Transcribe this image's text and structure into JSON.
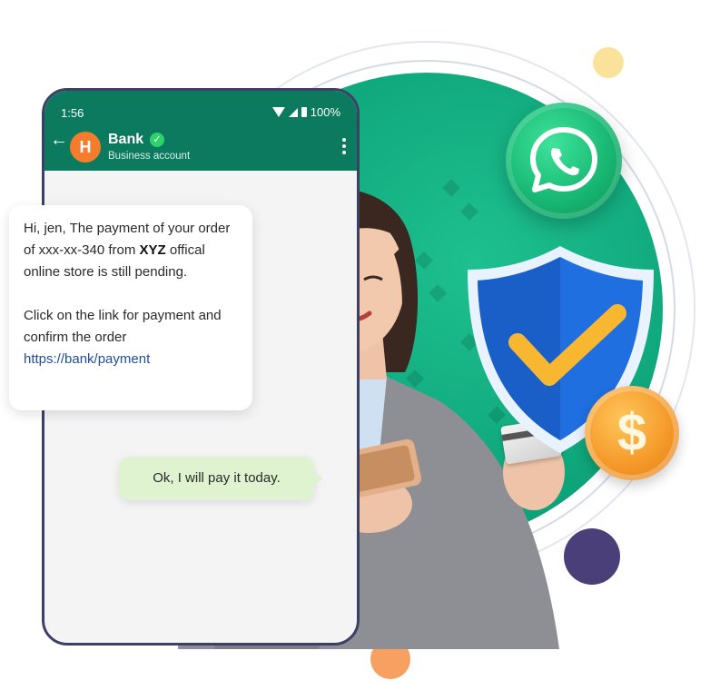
{
  "phone": {
    "status_time": "1:56",
    "battery": "100%",
    "contact_initial": "H",
    "contact_name": "Bank",
    "contact_subtitle": "Business account"
  },
  "messages": {
    "incoming": {
      "line1_part1": "Hi, jen, The payment of your order of xxx-xx-340 from ",
      "line1_bold": "XYZ",
      "line1_part2": " offical online store is still pending.",
      "line2": "Click on the link for payment and confirm the order",
      "link": "https://bank/payment"
    },
    "outgoing": "Ok, I will pay it today."
  },
  "icons": {
    "whatsapp": "whatsapp-icon",
    "shield": "shield-check-icon",
    "coin": "dollar-coin-icon",
    "coin_symbol": "$"
  },
  "colors": {
    "brand_green": "#0c7a5e",
    "disc_green": "#12b083",
    "avatar_orange": "#f47c2c",
    "link_blue": "#214d9b"
  }
}
